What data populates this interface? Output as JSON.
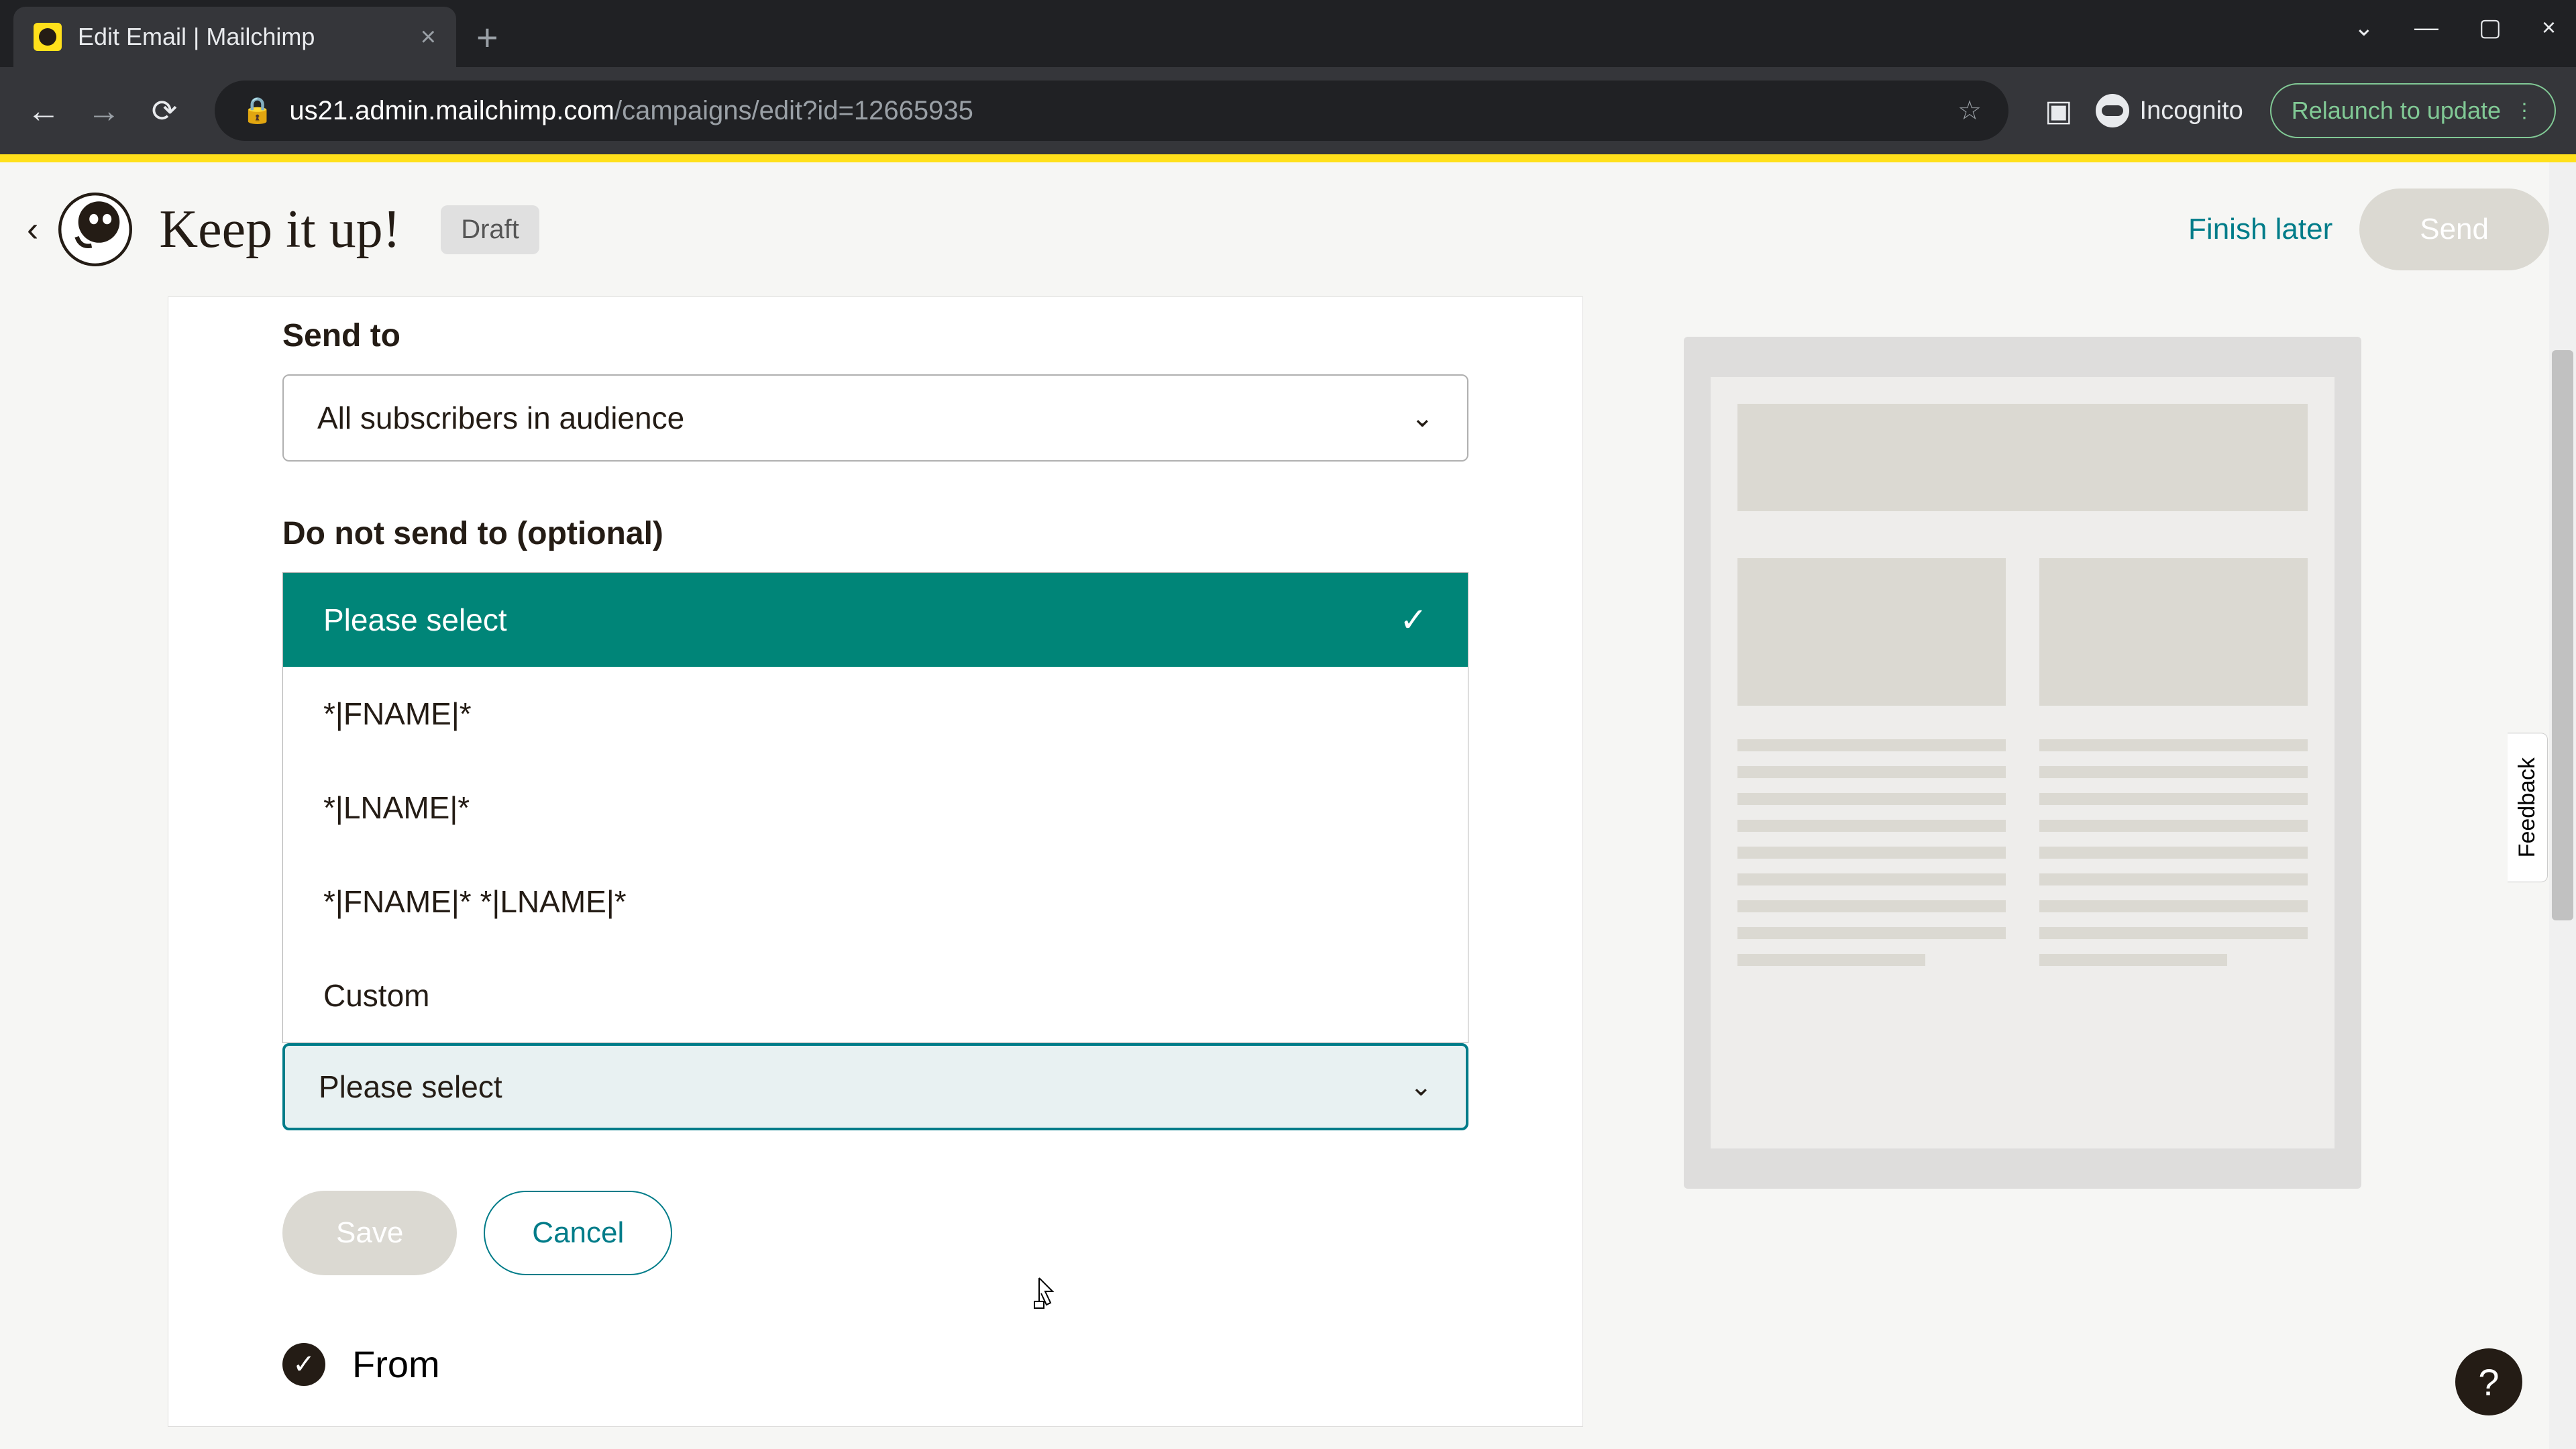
{
  "browser": {
    "tab_title": "Edit Email | Mailchimp",
    "url_host": "us21.admin.mailchimp.com",
    "url_path": "/campaigns/edit?id=12665935",
    "incognito_label": "Incognito",
    "relaunch_label": "Relaunch to update"
  },
  "header": {
    "title": "Keep it up!",
    "status_badge": "Draft",
    "finish_later": "Finish later",
    "send": "Send"
  },
  "form": {
    "send_to_label": "Send to",
    "send_to_value": "All subscribers in audience",
    "do_not_send_label": "Do not send to (optional)",
    "dropdown_options": {
      "selected": "Please select",
      "opt1": "*|FNAME|*",
      "opt2": "*|LNAME|*",
      "opt3": "*|FNAME|* *|LNAME|*",
      "opt4": "Custom"
    },
    "please_select": "Please select",
    "save": "Save",
    "cancel": "Cancel"
  },
  "from": {
    "label": "From"
  },
  "feedback": "Feedback",
  "help": "?"
}
